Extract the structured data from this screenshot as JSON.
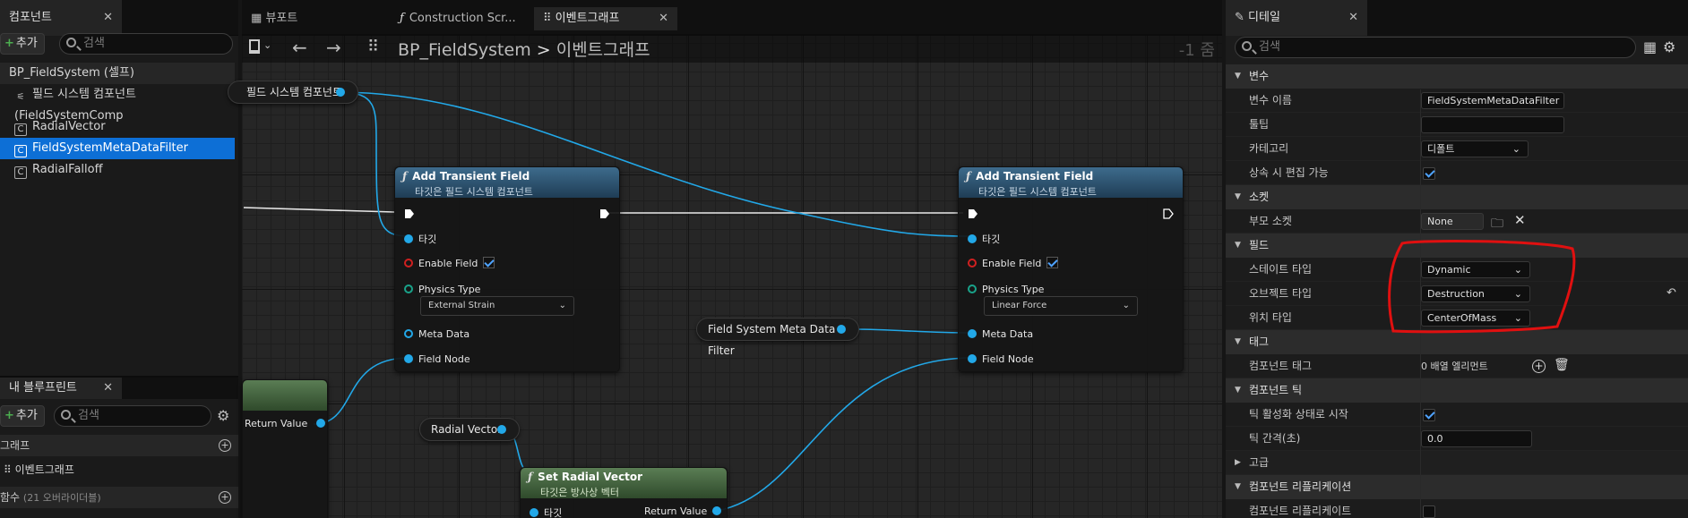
{
  "left": {
    "components_tab": "컴포넌트",
    "add_label": "추가",
    "search_placeholder": "검색",
    "tree": [
      {
        "label": "BP_FieldSystem (셀프)"
      },
      {
        "label": "필드 시스템 컴포넌트 (FieldSystemComp"
      },
      {
        "label": "RadialVector"
      },
      {
        "label": "FieldSystemMetaDataFilter"
      },
      {
        "label": "RadialFalloff"
      }
    ],
    "myblueprint_tab": "내 블루프린트",
    "graph_section": "그래프",
    "event_graph": "이벤트그래프",
    "functions": "함수",
    "functions_note": "(21 오버라이더블)"
  },
  "graph_tabs": {
    "viewport": "뷰포트",
    "construction": "Construction Scr...",
    "event_graph": "이벤트그래프"
  },
  "breadcrumb": {
    "bp": "BP_FieldSystem",
    "sep": ">",
    "graph": "이벤트그래프",
    "zoom": "-1 줌"
  },
  "nodes": {
    "field_component_var": "필드 시스템 컴포넌트",
    "add_field_title": "Add Transient Field",
    "add_field_sub": "타깃은 필드 시스템 컴포넌트",
    "pin_target": "타깃",
    "pin_enable": "Enable Field",
    "pin_physics": "Physics Type",
    "physics_left": "External Strain",
    "physics_right": "Linear Force",
    "pin_meta": "Meta Data",
    "pin_fieldnode": "Field Node",
    "meta_var": "Field System Meta Data Filter",
    "radial_var": "Radial Vector",
    "return_value": "Return Value",
    "set_radial_title": "Set Radial Vector",
    "set_radial_sub": "타깃은 방사상 벡터",
    "return_value2": "Return Value"
  },
  "details": {
    "tab": "디테일",
    "search_placeholder": "검색",
    "sections": {
      "variable": "변수",
      "socket": "소켓",
      "field": "필드",
      "tags": "태그",
      "comp_tick": "컴포넌트 틱",
      "advanced": "고급",
      "replication": "컴포넌트 리플리케이션"
    },
    "rows": {
      "var_name_label": "변수 이름",
      "var_name_value": "FieldSystemMetaDataFilter",
      "tooltip_label": "툴팁",
      "category_label": "카테고리",
      "category_value": "디폴트",
      "editable_label": "상속 시 편집 가능",
      "parent_socket_label": "부모 소켓",
      "parent_socket_value": "None",
      "state_type_label": "스테이트 타입",
      "state_type_value": "Dynamic",
      "object_type_label": "오브젝트 타입",
      "object_type_value": "Destruction",
      "position_type_label": "위치 타입",
      "position_type_value": "CenterOfMass",
      "comp_tags_label": "컴포넌트 태그",
      "comp_tags_value": "0 배열 엘리먼트",
      "tick_start_label": "틱 활성화 상태로 시작",
      "tick_interval_label": "틱 간격(초)",
      "tick_interval_value": "0.0",
      "comp_replicate_label": "컴포넌트 리플리케이트"
    }
  },
  "colors": {
    "accent": "#0d6fd6",
    "pin_blue": "#22a8e8",
    "annotation_red": "#e01010"
  }
}
